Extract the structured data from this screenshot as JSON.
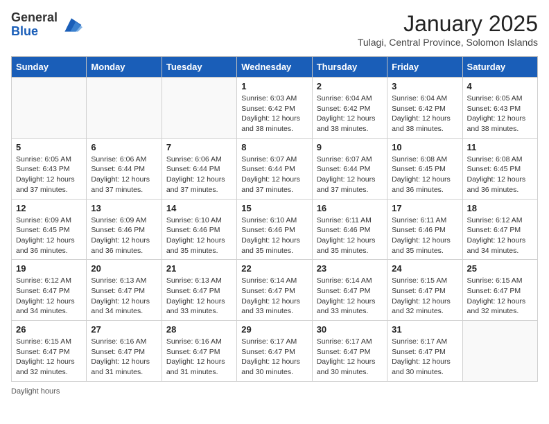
{
  "logo": {
    "general": "General",
    "blue": "Blue"
  },
  "header": {
    "month": "January 2025",
    "location": "Tulagi, Central Province, Solomon Islands"
  },
  "weekdays": [
    "Sunday",
    "Monday",
    "Tuesday",
    "Wednesday",
    "Thursday",
    "Friday",
    "Saturday"
  ],
  "footer": {
    "daylight_label": "Daylight hours"
  },
  "weeks": [
    [
      {
        "day": "",
        "info": ""
      },
      {
        "day": "",
        "info": ""
      },
      {
        "day": "",
        "info": ""
      },
      {
        "day": "1",
        "info": "Sunrise: 6:03 AM\nSunset: 6:42 PM\nDaylight: 12 hours\nand 38 minutes."
      },
      {
        "day": "2",
        "info": "Sunrise: 6:04 AM\nSunset: 6:42 PM\nDaylight: 12 hours\nand 38 minutes."
      },
      {
        "day": "3",
        "info": "Sunrise: 6:04 AM\nSunset: 6:42 PM\nDaylight: 12 hours\nand 38 minutes."
      },
      {
        "day": "4",
        "info": "Sunrise: 6:05 AM\nSunset: 6:43 PM\nDaylight: 12 hours\nand 38 minutes."
      }
    ],
    [
      {
        "day": "5",
        "info": "Sunrise: 6:05 AM\nSunset: 6:43 PM\nDaylight: 12 hours\nand 37 minutes."
      },
      {
        "day": "6",
        "info": "Sunrise: 6:06 AM\nSunset: 6:44 PM\nDaylight: 12 hours\nand 37 minutes."
      },
      {
        "day": "7",
        "info": "Sunrise: 6:06 AM\nSunset: 6:44 PM\nDaylight: 12 hours\nand 37 minutes."
      },
      {
        "day": "8",
        "info": "Sunrise: 6:07 AM\nSunset: 6:44 PM\nDaylight: 12 hours\nand 37 minutes."
      },
      {
        "day": "9",
        "info": "Sunrise: 6:07 AM\nSunset: 6:44 PM\nDaylight: 12 hours\nand 37 minutes."
      },
      {
        "day": "10",
        "info": "Sunrise: 6:08 AM\nSunset: 6:45 PM\nDaylight: 12 hours\nand 36 minutes."
      },
      {
        "day": "11",
        "info": "Sunrise: 6:08 AM\nSunset: 6:45 PM\nDaylight: 12 hours\nand 36 minutes."
      }
    ],
    [
      {
        "day": "12",
        "info": "Sunrise: 6:09 AM\nSunset: 6:45 PM\nDaylight: 12 hours\nand 36 minutes."
      },
      {
        "day": "13",
        "info": "Sunrise: 6:09 AM\nSunset: 6:46 PM\nDaylight: 12 hours\nand 36 minutes."
      },
      {
        "day": "14",
        "info": "Sunrise: 6:10 AM\nSunset: 6:46 PM\nDaylight: 12 hours\nand 35 minutes."
      },
      {
        "day": "15",
        "info": "Sunrise: 6:10 AM\nSunset: 6:46 PM\nDaylight: 12 hours\nand 35 minutes."
      },
      {
        "day": "16",
        "info": "Sunrise: 6:11 AM\nSunset: 6:46 PM\nDaylight: 12 hours\nand 35 minutes."
      },
      {
        "day": "17",
        "info": "Sunrise: 6:11 AM\nSunset: 6:46 PM\nDaylight: 12 hours\nand 35 minutes."
      },
      {
        "day": "18",
        "info": "Sunrise: 6:12 AM\nSunset: 6:47 PM\nDaylight: 12 hours\nand 34 minutes."
      }
    ],
    [
      {
        "day": "19",
        "info": "Sunrise: 6:12 AM\nSunset: 6:47 PM\nDaylight: 12 hours\nand 34 minutes."
      },
      {
        "day": "20",
        "info": "Sunrise: 6:13 AM\nSunset: 6:47 PM\nDaylight: 12 hours\nand 34 minutes."
      },
      {
        "day": "21",
        "info": "Sunrise: 6:13 AM\nSunset: 6:47 PM\nDaylight: 12 hours\nand 33 minutes."
      },
      {
        "day": "22",
        "info": "Sunrise: 6:14 AM\nSunset: 6:47 PM\nDaylight: 12 hours\nand 33 minutes."
      },
      {
        "day": "23",
        "info": "Sunrise: 6:14 AM\nSunset: 6:47 PM\nDaylight: 12 hours\nand 33 minutes."
      },
      {
        "day": "24",
        "info": "Sunrise: 6:15 AM\nSunset: 6:47 PM\nDaylight: 12 hours\nand 32 minutes."
      },
      {
        "day": "25",
        "info": "Sunrise: 6:15 AM\nSunset: 6:47 PM\nDaylight: 12 hours\nand 32 minutes."
      }
    ],
    [
      {
        "day": "26",
        "info": "Sunrise: 6:15 AM\nSunset: 6:47 PM\nDaylight: 12 hours\nand 32 minutes."
      },
      {
        "day": "27",
        "info": "Sunrise: 6:16 AM\nSunset: 6:47 PM\nDaylight: 12 hours\nand 31 minutes."
      },
      {
        "day": "28",
        "info": "Sunrise: 6:16 AM\nSunset: 6:47 PM\nDaylight: 12 hours\nand 31 minutes."
      },
      {
        "day": "29",
        "info": "Sunrise: 6:17 AM\nSunset: 6:47 PM\nDaylight: 12 hours\nand 30 minutes."
      },
      {
        "day": "30",
        "info": "Sunrise: 6:17 AM\nSunset: 6:47 PM\nDaylight: 12 hours\nand 30 minutes."
      },
      {
        "day": "31",
        "info": "Sunrise: 6:17 AM\nSunset: 6:47 PM\nDaylight: 12 hours\nand 30 minutes."
      },
      {
        "day": "",
        "info": ""
      }
    ]
  ]
}
